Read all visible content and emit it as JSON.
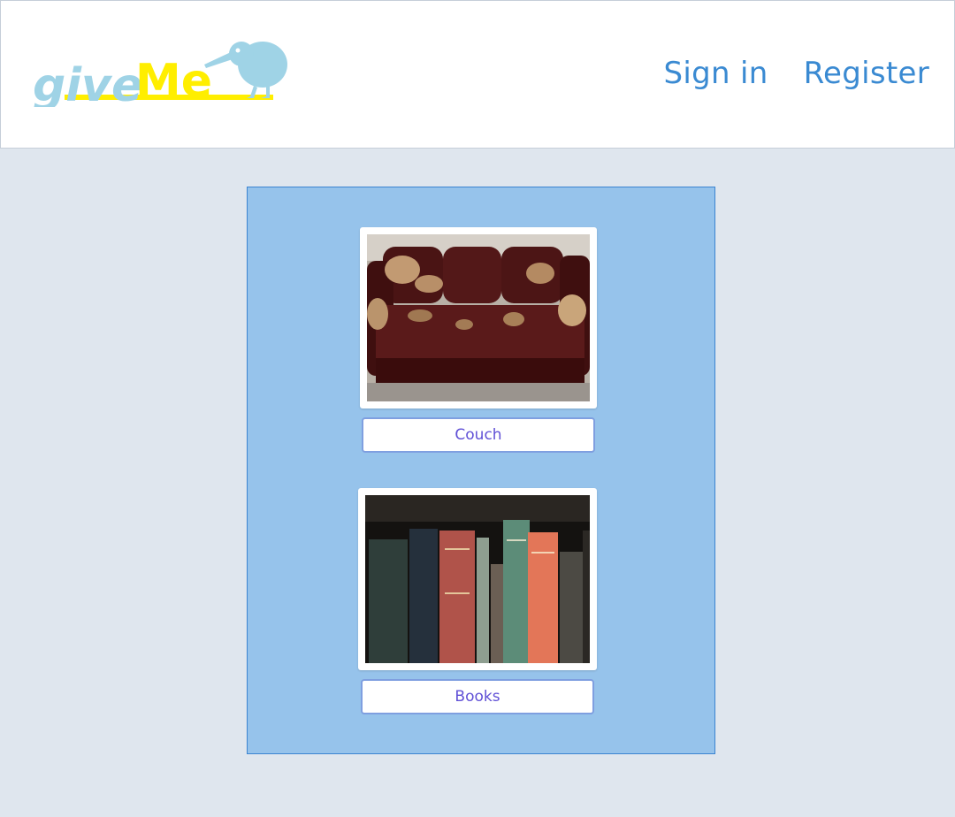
{
  "header": {
    "logo": {
      "text_part1": "give",
      "text_part2": "Me",
      "bird": "kiwi-bird-icon"
    },
    "nav": {
      "sign_in": "Sign in",
      "register": "Register"
    }
  },
  "items": [
    {
      "label": "Couch",
      "image": "couch-photo"
    },
    {
      "label": "Books",
      "image": "books-photo"
    }
  ],
  "colors": {
    "header_bg": "#ffffff",
    "page_bg": "#dfe6ee",
    "panel_bg": "#96c3eb",
    "panel_border": "#3b84d1",
    "nav_link": "#3a8ad2",
    "item_label": "#6050d6",
    "logo_blue": "#9fd3e6",
    "logo_yellow": "#ffee00"
  }
}
